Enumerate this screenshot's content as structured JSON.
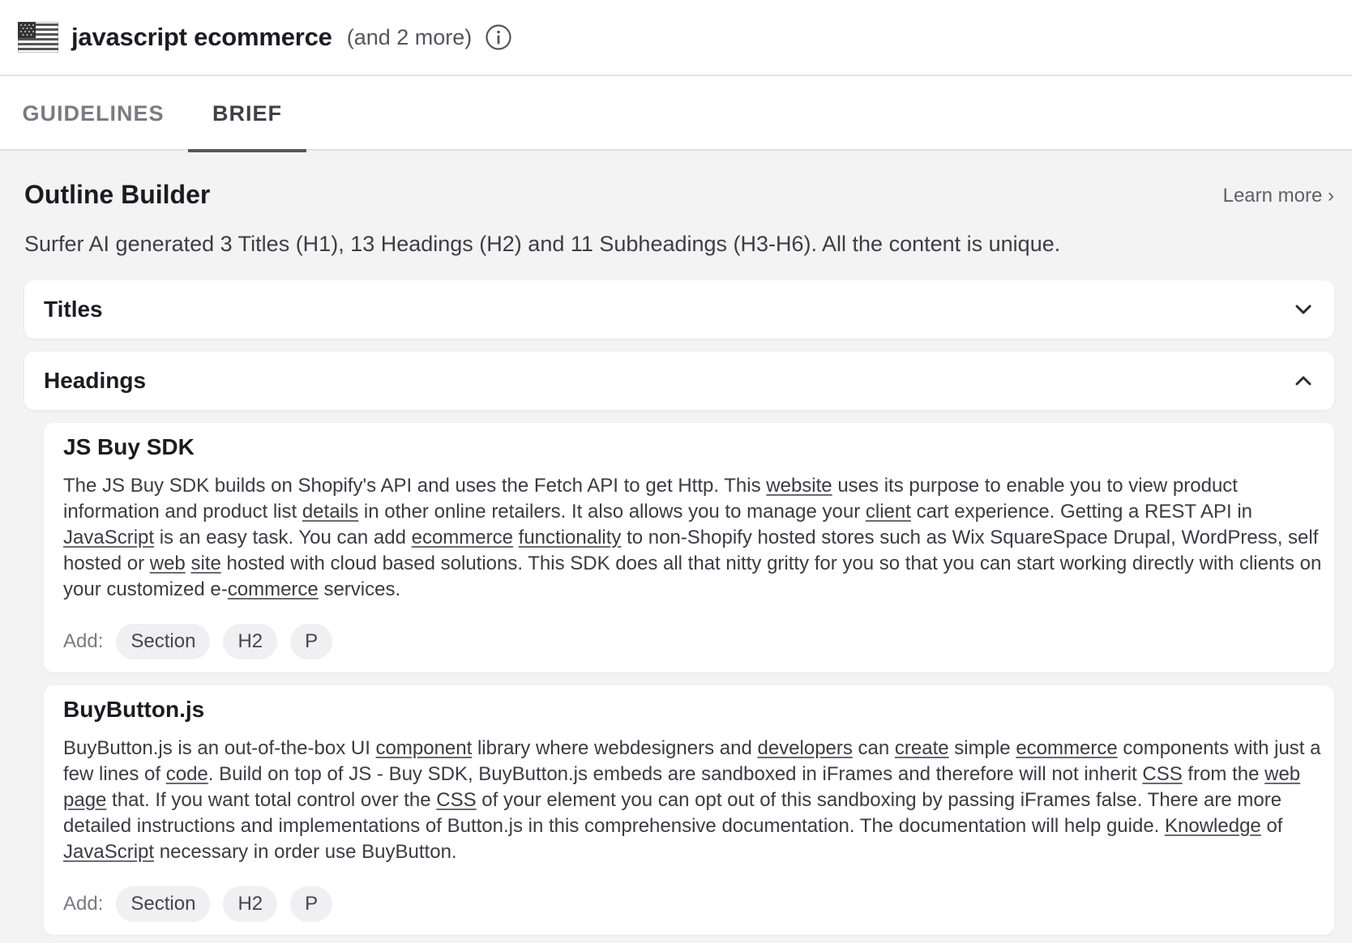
{
  "header": {
    "keyword": "javascript ecommerce",
    "more": "(and 2 more)",
    "flag_icon": "us-flag-icon",
    "info_icon": "info-circle-icon"
  },
  "tabs": [
    {
      "label": "GUIDELINES",
      "active": false
    },
    {
      "label": "BRIEF",
      "active": true
    }
  ],
  "outline": {
    "title": "Outline Builder",
    "learn_more": "Learn more ›",
    "description": "Surfer AI generated 3 Titles (H1), 13 Headings (H2) and 11 Subheadings (H3-H6). All the content is unique."
  },
  "sections": [
    {
      "label": "Titles",
      "expanded": false
    },
    {
      "label": "Headings",
      "expanded": true
    }
  ],
  "add_label": "Add:",
  "chips": [
    "Section",
    "H2",
    "P"
  ],
  "cards": [
    {
      "title": "JS Buy SDK",
      "segments": [
        {
          "t": "The JS Buy SDK builds on Shopify's API and uses the Fetch API to get Http. This "
        },
        {
          "t": "website",
          "link": true
        },
        {
          "t": " uses its purpose to enable you to view product information and product list "
        },
        {
          "t": "details",
          "link": true
        },
        {
          "t": " in other online retailers. It also allows you to manage your "
        },
        {
          "t": "client",
          "link": true
        },
        {
          "t": " cart experience. Getting a REST API in "
        },
        {
          "t": "JavaScript",
          "link": true
        },
        {
          "t": " is an easy task. You can add "
        },
        {
          "t": "ecommerce",
          "link": true
        },
        {
          "t": " "
        },
        {
          "t": "functionality",
          "link": true
        },
        {
          "t": " to non-Shopify hosted stores such as Wix SquareSpace Drupal, WordPress, self hosted or "
        },
        {
          "t": "web",
          "link": true
        },
        {
          "t": " "
        },
        {
          "t": "site",
          "link": true
        },
        {
          "t": " hosted with cloud based solutions. This SDK does all that nitty gritty for you so that you can start working directly with clients on your customized e-"
        },
        {
          "t": "commerce",
          "link": true
        },
        {
          "t": " services."
        }
      ]
    },
    {
      "title": "BuyButton.js",
      "segments": [
        {
          "t": "BuyButton.js is an out-of-the-box UI "
        },
        {
          "t": "component",
          "link": true
        },
        {
          "t": " library where webdesigners and "
        },
        {
          "t": "developers",
          "link": true
        },
        {
          "t": " can "
        },
        {
          "t": "create",
          "link": true
        },
        {
          "t": " simple "
        },
        {
          "t": "ecommerce",
          "link": true
        },
        {
          "t": " components with just a few lines of "
        },
        {
          "t": "code",
          "link": true
        },
        {
          "t": ". Build on top of JS - Buy SDK, BuyButton.js embeds are sandboxed in iFrames and therefore will not inherit "
        },
        {
          "t": "CSS",
          "link": true
        },
        {
          "t": " from the "
        },
        {
          "t": "web",
          "link": true
        },
        {
          "t": " "
        },
        {
          "t": "page",
          "link": true
        },
        {
          "t": " that. If you want total control over the "
        },
        {
          "t": "CSS",
          "link": true
        },
        {
          "t": " of your element you can opt out of this sandboxing by passing iFrames false. There are more detailed instructions and implementations of Button.js in this comprehensive documentation. The documentation will help guide. "
        },
        {
          "t": "Knowledge",
          "link": true
        },
        {
          "t": " of "
        },
        {
          "t": "JavaScript",
          "link": true
        },
        {
          "t": " necessary in order use BuyButton."
        }
      ]
    }
  ]
}
